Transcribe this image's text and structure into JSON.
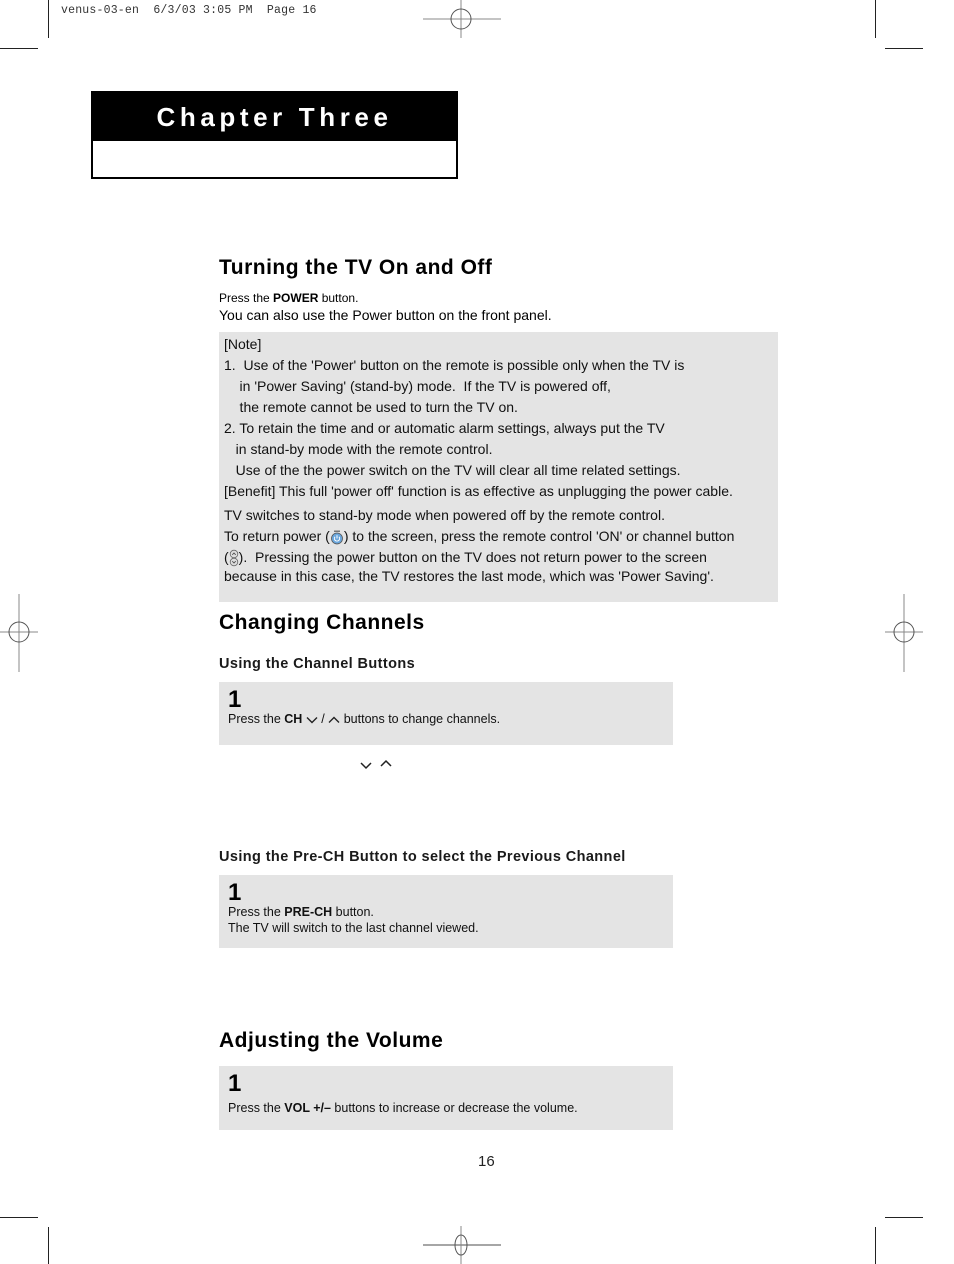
{
  "print_slug": "venus-03-en  6/3/03 3:05 PM  Page 16",
  "chapter": {
    "title": "Chapter Three"
  },
  "sections": {
    "turning_on_off": {
      "heading": "Turning the TV On and Off",
      "line1_prefix": "Press the ",
      "line1_bold": "POWER",
      "line1_suffix": " button.",
      "line2": "You can also use the Power button on the front panel.",
      "note": {
        "lines": [
          "[Note]",
          "1.  Use of the 'Power' button on the remote is possible only when the TV is",
          "    in 'Power Saving' (stand-by) mode.  If the TV is powered off,",
          "    the remote cannot be used to turn the TV on.",
          "2. To retain the time and or automatic alarm settings, always put the TV",
          "   in stand-by mode with the remote control.",
          "   Use of the the power switch on the TV will clear all time related settings.",
          "[Benefit] This full 'power off' function is as effective as unplugging the power cable."
        ],
        "standby_line": "TV switches to stand-by mode when powered off by the remote control.",
        "return_prefix": "To return power (",
        "return_suffix": ") to the screen, press the remote control 'ON' or channel button",
        "pressing_prefix": "(",
        "pressing_suffix": ").  Pressing the power button on the TV does not return power to the screen",
        "last_line": "because in this case, the TV restores the last mode, which was 'Power Saving'.",
        "icons": {
          "power": "power-button-icon",
          "channel": "channel-button-icon"
        }
      }
    },
    "changing_channels": {
      "heading": "Changing Channels",
      "channel_buttons": {
        "subheading": "Using the Channel Buttons",
        "step_number": "1",
        "text_prefix": "Press the ",
        "text_bold": "CH",
        "text_sep": " / ",
        "text_suffix": " buttons to change channels.",
        "icons": [
          "chevron-down-icon",
          "chevron-up-icon"
        ]
      },
      "pre_ch": {
        "subheading": "Using the Pre-CH Button to select the Previous Channel",
        "step_number": "1",
        "text_prefix": "Press the ",
        "text_bold": "PRE-CH",
        "text_suffix": " button.",
        "text_line2": "The TV will switch to the last channel viewed."
      }
    },
    "volume": {
      "heading": "Adjusting the Volume",
      "step_number": "1",
      "text_prefix": "Press the ",
      "text_bold": "VOL +/–",
      "text_suffix": " buttons to increase or decrease the volume."
    }
  },
  "page_number": "16",
  "colors": {
    "panel": "#e4e4e4",
    "chapter_bar": "#000000",
    "icon_blue": "#3a7bbf"
  }
}
